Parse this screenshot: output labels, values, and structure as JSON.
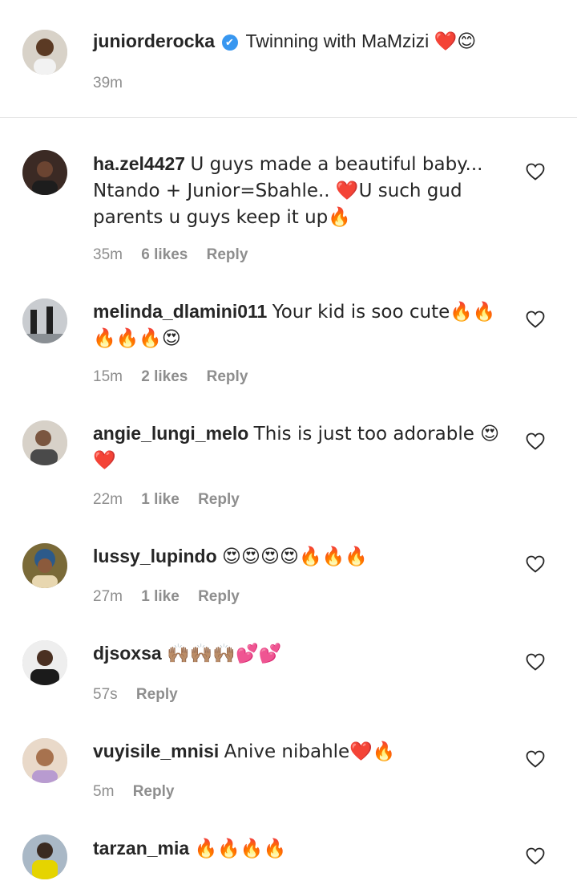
{
  "caption": {
    "username": "juniorderocka",
    "verified_mark": "✔",
    "text": "Twinning with MaMzizi",
    "emoji": "❤️😊",
    "time": "39m"
  },
  "comments": [
    {
      "username": "ha.zel4427",
      "text": "U guys made a beautiful baby... Ntando + Junior=Sbahle.. ❤️U such gud parents u guys keep it up🔥",
      "time": "35m",
      "likes": "6 likes",
      "reply": "Reply"
    },
    {
      "username": "melinda_dlamini011",
      "text": "Your kid is soo cute🔥🔥🔥🔥🔥😍",
      "time": "15m",
      "likes": "2 likes",
      "reply": "Reply"
    },
    {
      "username": "angie_lungi_melo",
      "text": "This is just too adorable 😍❤️",
      "time": "22m",
      "likes": "1 like",
      "reply": "Reply"
    },
    {
      "username": "lussy_lupindo",
      "text": "😍😍😍😍🔥🔥🔥",
      "time": "27m",
      "likes": "1 like",
      "reply": "Reply"
    },
    {
      "username": "djsoxsa",
      "text": "🙌🏽🙌🏽🙌🏽💕💕",
      "time": "57s",
      "likes": "",
      "reply": "Reply"
    },
    {
      "username": "vuyisile_mnisi",
      "text": "Anive nibahle❤️🔥",
      "time": "5m",
      "likes": "",
      "reply": "Reply"
    },
    {
      "username": "tarzan_mia",
      "text": "🔥🔥🔥🔥",
      "time": "",
      "likes": "",
      "reply": ""
    }
  ],
  "icons": {
    "like": "heart-outline-icon",
    "verified": "verified-badge-icon"
  },
  "colors": {
    "text": "#262626",
    "meta": "#8e8e8e",
    "verified": "#3897f0",
    "divider": "#e6e6e6"
  }
}
